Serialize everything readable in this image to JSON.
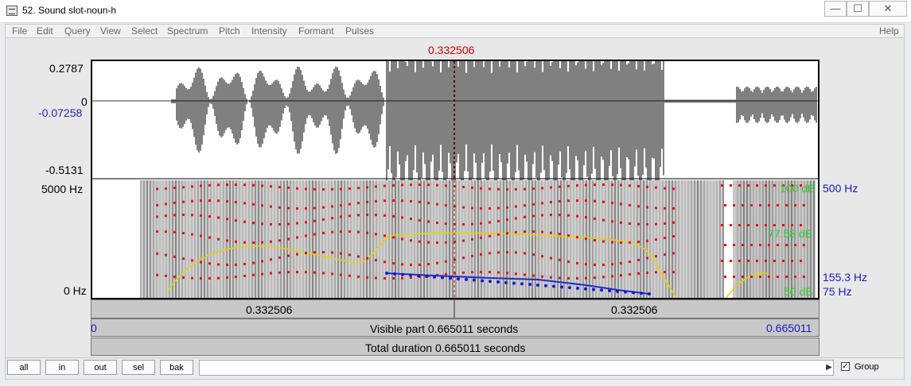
{
  "window": {
    "title": "52. Sound slot-noun-h",
    "controls": {
      "minimize": "—",
      "maximize": "☐",
      "close": "✕"
    }
  },
  "menu": [
    "File",
    "Edit",
    "Query",
    "View",
    "Select",
    "Spectrum",
    "Pitch",
    "Intensity",
    "Formant",
    "Pulses"
  ],
  "menu_help": "Help",
  "cursor": {
    "time": "0.332506"
  },
  "waveform": {
    "y_top": "0.2787",
    "y_zero": "0",
    "y_cursor_value": "-0.07258",
    "y_bottom": "-0.5131"
  },
  "spectrogram": {
    "freq_top": "5000 Hz",
    "freq_bottom": "0 Hz",
    "pitch_value": "155.3 Hz",
    "pitch_top": "500 Hz",
    "pitch_bottom": "75 Hz",
    "intensity_top": "100 dB",
    "intensity_value": "77.58 dB",
    "intensity_bottom": "50 dB"
  },
  "time_bar": {
    "left_segment": "0.332506",
    "right_segment": "0.332506",
    "visible_start": "0",
    "visible_label": "Visible part 0.665011 seconds",
    "visible_end": "0.665011",
    "total_label": "Total duration 0.665011 seconds"
  },
  "buttons": {
    "all": "all",
    "in": "in",
    "out": "out",
    "sel": "sel",
    "bak": "bak"
  },
  "group": {
    "label": "Group",
    "checked": true
  }
}
